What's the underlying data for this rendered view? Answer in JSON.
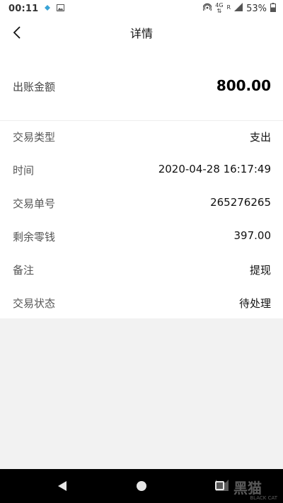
{
  "status_bar": {
    "time": "00:11",
    "network_top": "4G",
    "network_roaming": "R",
    "battery": "53%"
  },
  "header": {
    "title": "详情"
  },
  "detail": {
    "amount_label": "出账金额",
    "amount_value": "800.00",
    "rows": [
      {
        "label": "交易类型",
        "value": "支出"
      },
      {
        "label": "时间",
        "value": "2020-04-28 16:17:49"
      },
      {
        "label": "交易单号",
        "value": "265276265"
      },
      {
        "label": "剩余零钱",
        "value": "397.00"
      },
      {
        "label": "备注",
        "value": "提现"
      },
      {
        "label": "交易状态",
        "value": "待处理"
      }
    ]
  },
  "watermark": {
    "text": "黑猫",
    "subtext": "BLACK CAT"
  },
  "colors": {
    "background": "#f2f2f2",
    "surface": "#ffffff",
    "navbar": "#000000"
  }
}
